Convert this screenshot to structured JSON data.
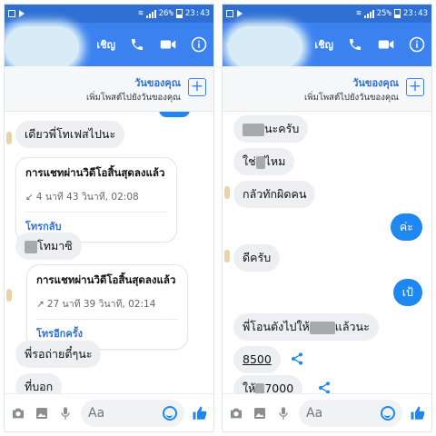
{
  "colors": {
    "accent": "#3b82f0",
    "outgoing": "#1e88f0",
    "incoming": "#edeff2",
    "status_bar": "#2f6fd4"
  },
  "left": {
    "status": {
      "battery": "26%",
      "time": "23:43"
    },
    "header": {
      "invite_label": "เชิญ",
      "icons": [
        "phone-icon",
        "video-icon",
        "info-icon"
      ]
    },
    "story": {
      "title": "วันของคุณ",
      "subtitle": "เพิ่มโพสต์ไปยังวันของคุณ",
      "add_icon": "plus-icon"
    },
    "messages": [
      {
        "text": "เดียวพี่โทเฟสไปนะ"
      },
      {
        "text": "โทมาซิ"
      },
      {
        "text": "พี่รอถ่ายตี๋ๆนะ"
      },
      {
        "text": "ที่บอก"
      }
    ],
    "calls": [
      {
        "title": "การแชทผ่านวิดีโอสิ้นสุดลงแล้ว",
        "arrow": "↙",
        "duration": "4 นาที 43 วินาที, 02:08",
        "action": "โทรกลับ"
      },
      {
        "title": "การแชทผ่านวิดีโอสิ้นสุดลงแล้ว",
        "arrow": "↗",
        "duration": "27 นาที 39 วินาที, 02:14",
        "action": "โทรอีกครั้ง"
      }
    ],
    "composer": {
      "placeholder": "Aa"
    }
  },
  "right": {
    "status": {
      "battery": "25%",
      "time": "23:43"
    },
    "header": {
      "invite_label": "เชิญ",
      "icons": [
        "phone-icon",
        "video-icon",
        "info-icon"
      ]
    },
    "story": {
      "title": "วันของคุณ",
      "subtitle": "เพิ่มโพสต์ไปยังวันของคุณ",
      "add_icon": "plus-icon"
    },
    "messages": [
      {
        "text": "นะครับ"
      },
      {
        "text_a": "ใช่",
        "text_b": "ไหม"
      },
      {
        "text": "กลัวทักผิดคน"
      },
      {
        "text": "ค่ะ"
      },
      {
        "text": "ดีครับ"
      },
      {
        "text": "เป้"
      },
      {
        "text_a": "พี่โอนตังไปให้",
        "text_b": "แล้วนะ"
      },
      {
        "text": "8500"
      },
      {
        "text_a": "ให้",
        "text_b": "7000"
      }
    ],
    "composer": {
      "placeholder": "Aa"
    }
  }
}
